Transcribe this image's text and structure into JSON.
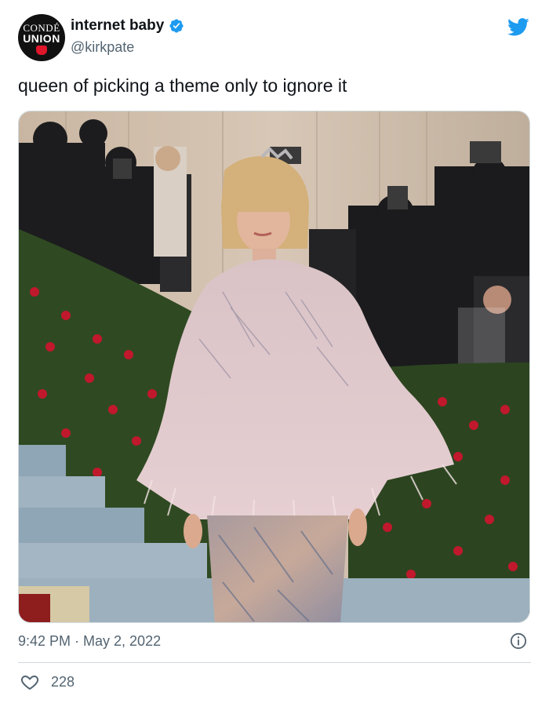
{
  "author": {
    "display_name": "internet baby",
    "handle": "@kirkpate",
    "avatar_text_line1": "CONDÉ",
    "avatar_text_line2": "UNION",
    "verified": true
  },
  "tweet": {
    "text": "queen of picking a theme only to ignore it",
    "timestamp": "9:42 PM · May 2, 2022",
    "likes": "228"
  },
  "colors": {
    "brand_blue": "#1d9bf0",
    "text_primary": "#0f1419",
    "text_secondary": "#536471",
    "border": "#cfd9de"
  },
  "icons": [
    "verified-badge-icon",
    "twitter-bird-icon",
    "info-icon",
    "heart-icon"
  ]
}
